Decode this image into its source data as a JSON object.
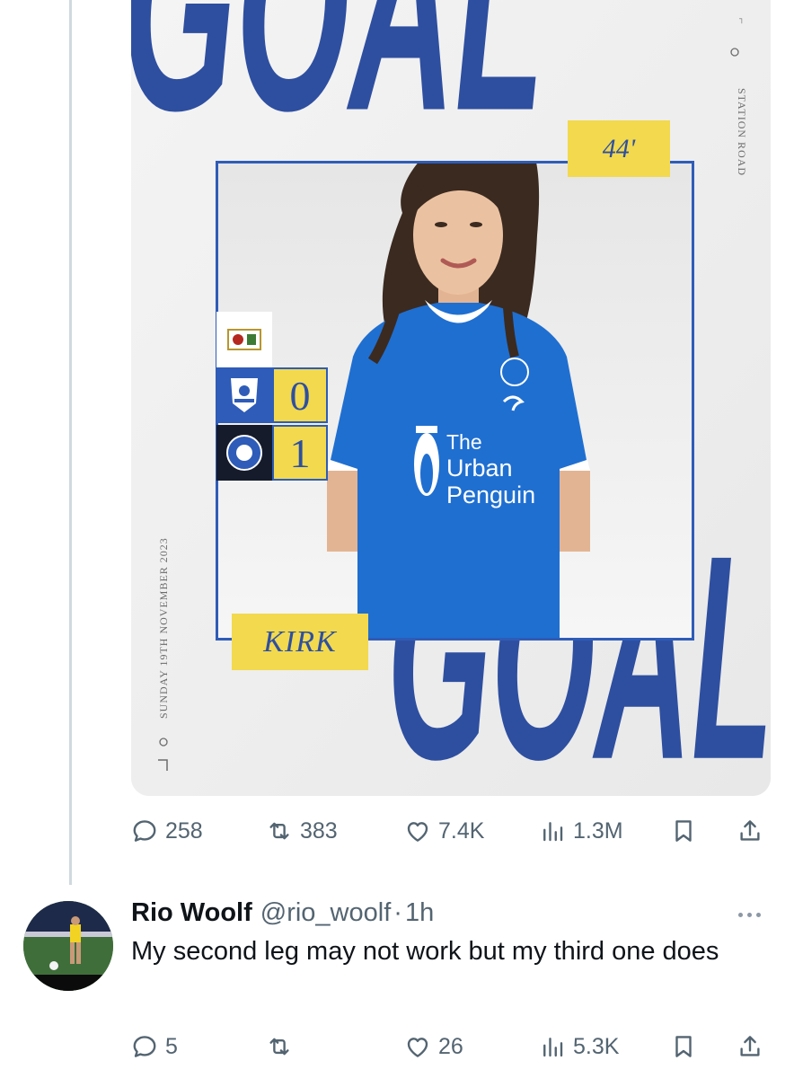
{
  "media": {
    "goal_word_top": "GOAL",
    "goal_word_bottom": "GOAL",
    "venue": "STATION ROAD",
    "date_text": "SUNDAY 19TH NOVEMBER 2023",
    "minute": "44'",
    "scorer": "KIRK",
    "score_home": "0",
    "score_away": "1",
    "shirt_sponsor": [
      "The",
      "Urban",
      "Penguin"
    ],
    "colors": {
      "brand_blue": "#2e4fa0",
      "frame_blue": "#2e5cb8",
      "yellow": "#f2d94e",
      "shirt_blue": "#1f6fd1"
    }
  },
  "tweet_actions": {
    "replies": "258",
    "reposts": "383",
    "likes": "7.4K",
    "views": "1.3M",
    "icons": [
      "reply-icon",
      "repost-icon",
      "like-icon",
      "views-icon",
      "bookmark-icon",
      "share-icon"
    ]
  },
  "reply": {
    "name": "Rio Woolf",
    "handle": "@rio_woolf",
    "separator": "·",
    "time": "1h",
    "text": "My second leg may not work but my third one does",
    "actions": {
      "replies": "5",
      "reposts": "",
      "likes": "26",
      "views": "5.3K"
    }
  }
}
